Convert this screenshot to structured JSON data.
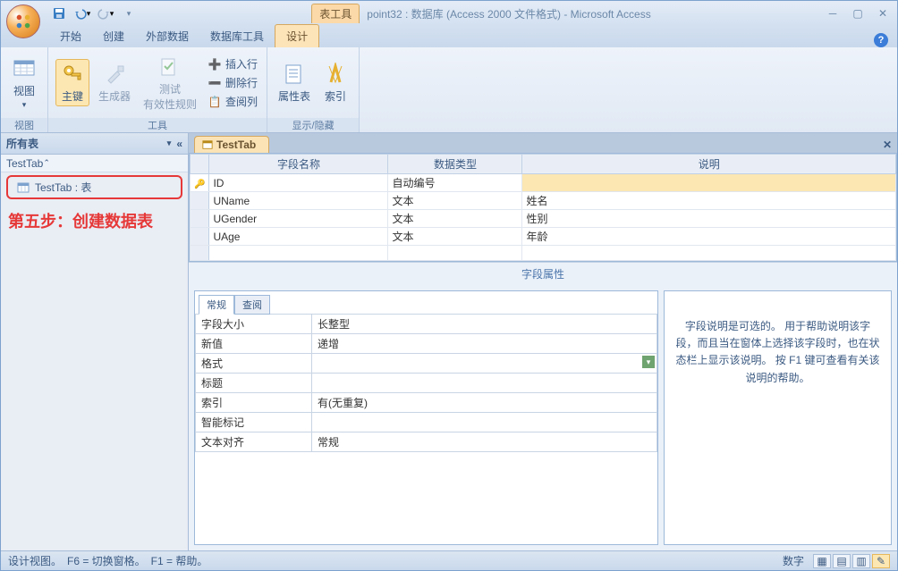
{
  "title": {
    "tools_label": "表工具",
    "text": "point32 : 数据库 (Access 2000 文件格式) - Microsoft Access"
  },
  "ribbon_tabs": {
    "t0": "开始",
    "t1": "创建",
    "t2": "外部数据",
    "t3": "数据库工具",
    "t4": "设计"
  },
  "ribbon": {
    "g_view": {
      "label": "视图",
      "btn_view": "视图"
    },
    "g_tools": {
      "label": "工具",
      "btn_pk": "主键",
      "btn_builder": "生成器",
      "btn_test": "测试\n有效性规则",
      "btn_insert": "插入行",
      "btn_delete": "删除行",
      "btn_lookup": "查阅列"
    },
    "g_showhide": {
      "label": "显示/隐藏",
      "btn_sheet": "属性表",
      "btn_index": "索引"
    }
  },
  "nav": {
    "header": "所有表",
    "group": "TestTab",
    "item": "TestTab : 表"
  },
  "annotation": "第五步：创建数据表",
  "doc_tab": "TestTab",
  "grid": {
    "col_name": "字段名称",
    "col_type": "数据类型",
    "col_desc": "说明",
    "rows": [
      {
        "name": "ID",
        "type": "自动编号",
        "desc": ""
      },
      {
        "name": "UName",
        "type": "文本",
        "desc": "姓名"
      },
      {
        "name": "UGender",
        "type": "文本",
        "desc": "性别"
      },
      {
        "name": "UAge",
        "type": "文本",
        "desc": "年龄"
      }
    ]
  },
  "props_header": "字段属性",
  "props_tabs": {
    "t0": "常规",
    "t1": "查阅"
  },
  "props": [
    {
      "k": "字段大小",
      "v": "长整型"
    },
    {
      "k": "新值",
      "v": "递增"
    },
    {
      "k": "格式",
      "v": ""
    },
    {
      "k": "标题",
      "v": ""
    },
    {
      "k": "索引",
      "v": "有(无重复)"
    },
    {
      "k": "智能标记",
      "v": ""
    },
    {
      "k": "文本对齐",
      "v": "常规"
    }
  ],
  "help_text": "字段说明是可选的。 用于帮助说明该字段，而且当在窗体上选择该字段时，也在状态栏上显示该说明。 按 F1 键可查看有关该说明的帮助。",
  "status": {
    "left": "设计视图。　F6 = 切换窗格。　F1 = 帮助。",
    "right": "数字"
  }
}
